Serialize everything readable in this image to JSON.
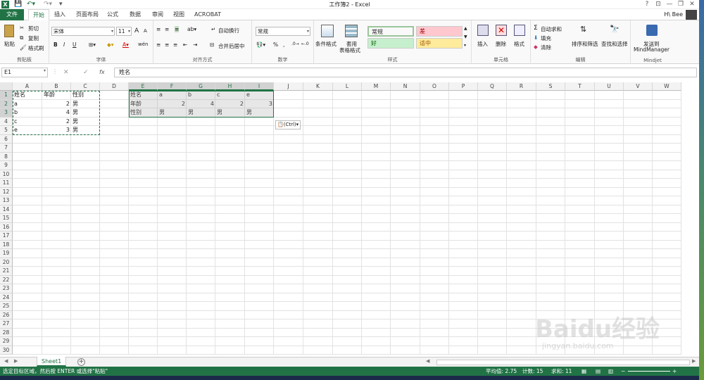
{
  "titlebar": {
    "title": "工作簿2 - Excel",
    "help": "?",
    "restore_ribbon": "⊡",
    "minimize": "—",
    "maximize": "❐",
    "close": "✕"
  },
  "tabs": {
    "file": "文件",
    "items": [
      "开始",
      "插入",
      "页面布局",
      "公式",
      "数据",
      "审阅",
      "视图",
      "ACROBAT"
    ],
    "active_index": 0
  },
  "user": {
    "name": "H\\ Bee"
  },
  "ribbon": {
    "clipboard": {
      "label": "剪贴板",
      "paste": "粘贴",
      "cut": "剪切",
      "copy": "复制",
      "format_painter": "格式刷"
    },
    "font": {
      "label": "字体",
      "font_name": "宋体",
      "font_size": "11",
      "bold": "B",
      "italic": "I",
      "underline": "U",
      "grow": "A",
      "shrink": "A",
      "wen": "wén"
    },
    "alignment": {
      "label": "对齐方式",
      "wrap": "自动换行",
      "merge": "合并后居中"
    },
    "number": {
      "label": "数字",
      "format": "常规",
      "percent": "%",
      "comma": ","
    },
    "styles": {
      "label": "样式",
      "conditional": "条件格式",
      "table": "套用",
      "table2": "表格格式",
      "normal": "常规",
      "bad": "差",
      "good": "好",
      "neutral": "适中"
    },
    "cells": {
      "label": "单元格",
      "insert": "插入",
      "delete": "删除",
      "format": "格式"
    },
    "editing": {
      "label": "编辑",
      "autosum": "自动求和",
      "fill": "填充",
      "clear": "清除",
      "sort": "排序和筛选",
      "find": "查找和选择"
    },
    "mindjet": {
      "label": "Mindjet",
      "send": "发送到",
      "send2": "MindManager"
    }
  },
  "formula_bar": {
    "name_box": "E1",
    "fx": "fx",
    "value": "姓名"
  },
  "columns": [
    "A",
    "B",
    "C",
    "D",
    "E",
    "F",
    "G",
    "H",
    "I",
    "J",
    "K",
    "L",
    "M",
    "N",
    "O",
    "P",
    "Q",
    "R",
    "S",
    "T",
    "U",
    "V",
    "W"
  ],
  "rows": [
    "1",
    "2",
    "3",
    "4",
    "5",
    "6",
    "7",
    "8",
    "9",
    "10",
    "11",
    "12",
    "13",
    "14",
    "15",
    "16",
    "17",
    "18",
    "19",
    "20",
    "21",
    "22",
    "23",
    "24",
    "25",
    "26",
    "27",
    "28",
    "29",
    "30"
  ],
  "source_table": {
    "headers": [
      "姓名",
      "年龄",
      "性别"
    ],
    "rows": [
      [
        "a",
        "2",
        "男"
      ],
      [
        "b",
        "4",
        "男"
      ],
      [
        "c",
        "2",
        "男"
      ],
      [
        "e",
        "3",
        "男"
      ]
    ]
  },
  "transposed_table": {
    "rows": [
      [
        "姓名",
        "a",
        "b",
        "c",
        "e"
      ],
      [
        "年龄",
        "2",
        "4",
        "2",
        "3"
      ],
      [
        "性别",
        "男",
        "男",
        "男",
        "男"
      ]
    ]
  },
  "paste_options": "(Ctrl)",
  "sheet_tab": "Sheet1",
  "status": {
    "message": "选定目标区域，然后按 ENTER 或选择\"粘贴\"",
    "average": "平均值: 2.75",
    "count": "计数: 15",
    "sum": "求和: 11"
  },
  "watermark": {
    "text": "Baidu经验",
    "url": "jingyan.baidu.com"
  }
}
